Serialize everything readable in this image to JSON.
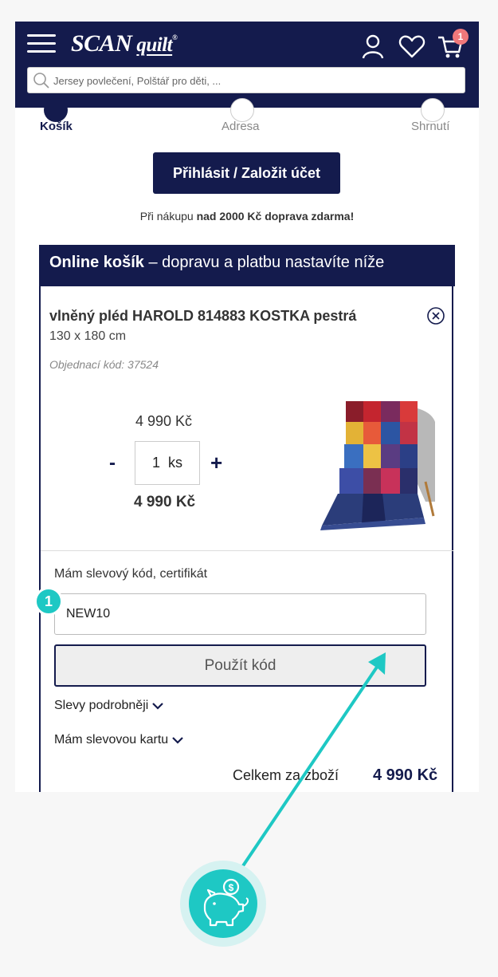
{
  "header": {
    "logo_main": "SCAN",
    "logo_sub": "quilt",
    "logo_mark": "®",
    "cart_count": "1",
    "search_placeholder": "Jersey povlečení, Polštář pro děti, ..."
  },
  "steps": [
    {
      "label": "Košík",
      "active": true
    },
    {
      "label": "Adresa",
      "active": false
    },
    {
      "label": "Shrnutí",
      "active": false
    }
  ],
  "login_button": "Přihlásit / Založit účet",
  "shipping_note": {
    "prefix": "Při nákupu ",
    "bold": "nad 2000 Kč doprava zdarma!"
  },
  "cart": {
    "title_bold": "Online košík",
    "title_rest": " – dopravu a platbu nastavíte níže",
    "product": {
      "name": "vlněný pléd HAROLD 814883 KOSTKA pestrá",
      "size": "130 x 180 cm",
      "code": "Objednací kód: 37524",
      "unit_price": "4 990 Kč",
      "quantity": "1",
      "unit": "ks",
      "total": "4 990 Kč",
      "minus": "-",
      "plus": "+"
    },
    "discount": {
      "label": "Mám slevový kód, certifikát",
      "value": "NEW10",
      "apply_label": "Použít kód",
      "details_label": "Slevy podrobněji",
      "card_label": "Mám slevovou kartu"
    },
    "summary": {
      "label": "Celkem za zboží",
      "value": "4 990 Kč"
    }
  },
  "annotation": {
    "step_number": "1",
    "accent_color": "#1ec8c4"
  },
  "colors": {
    "navy": "#141b4d",
    "badge_red": "#f0787b",
    "teal": "#1ec8c4"
  }
}
